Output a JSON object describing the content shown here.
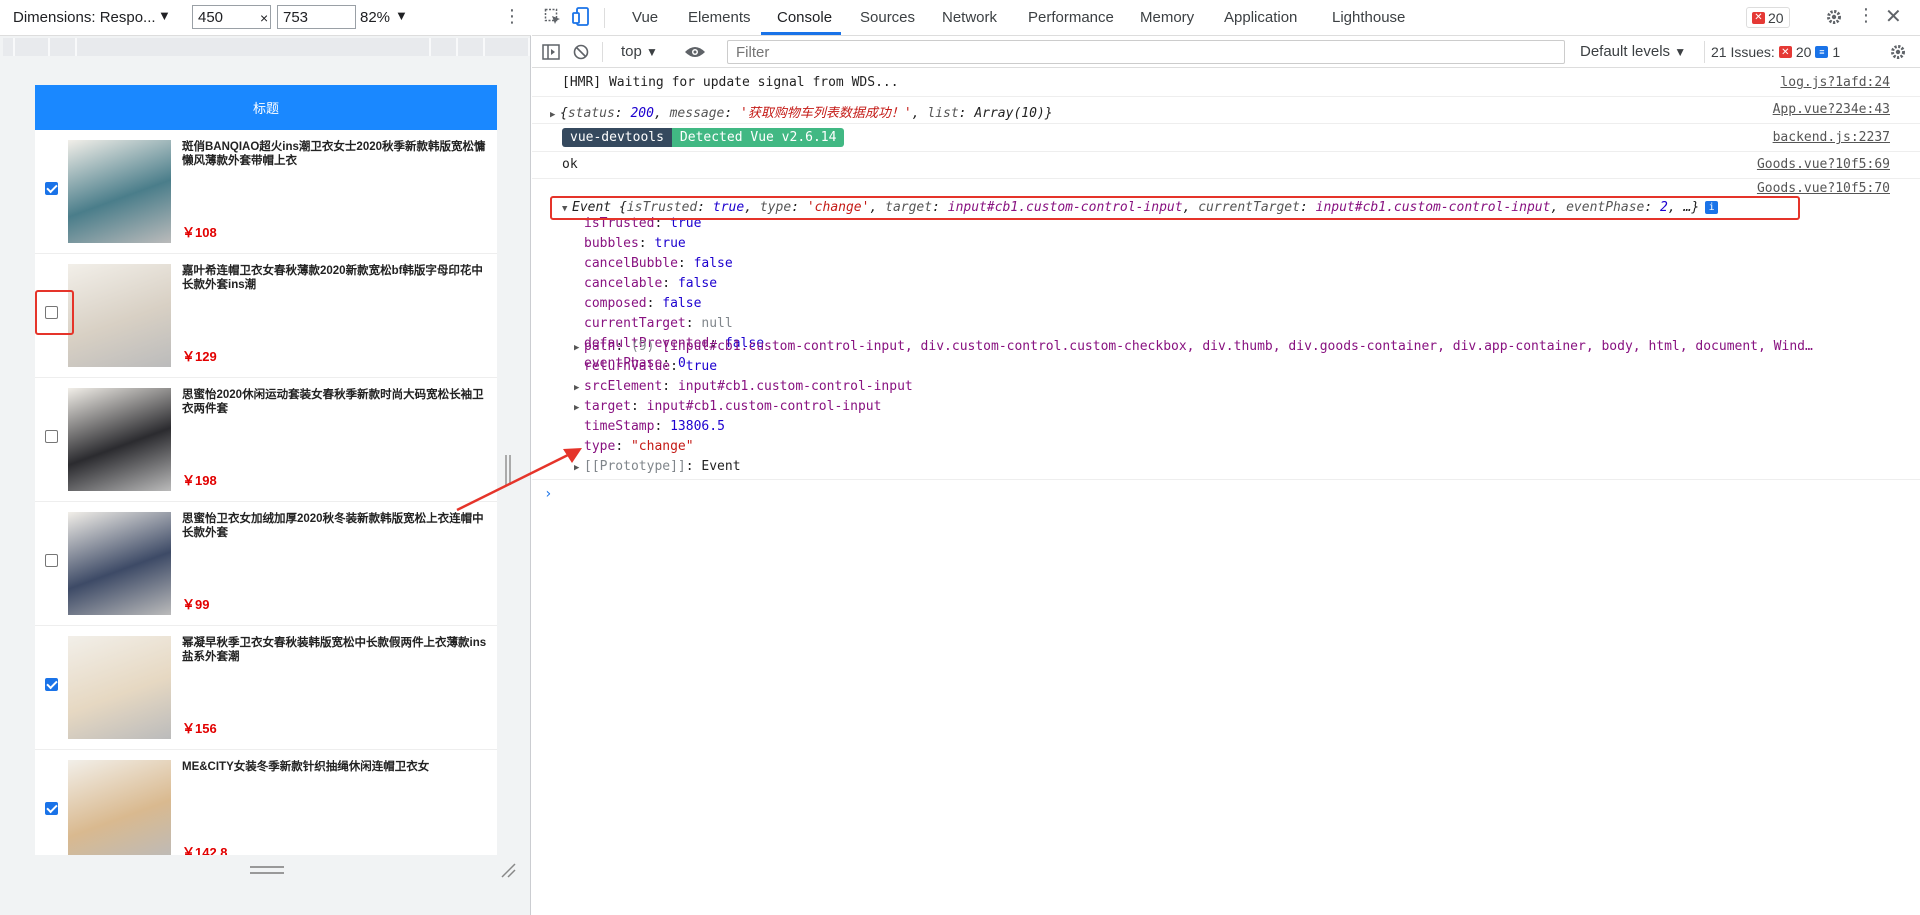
{
  "emulation": {
    "device_label": "Dimensions: Respo...",
    "width": "450",
    "height": "753",
    "times": "×",
    "zoom": "82%",
    "caret": "▼",
    "more": "⋮"
  },
  "app": {
    "header_title": "标题",
    "goods": [
      {
        "title": "斑俏BANQIAO超火ins潮卫衣女士2020秋季新款韩版宽松慵懒风薄款外套带帽上衣",
        "price": "￥108",
        "checked": true,
        "img_color": "#4a7d8a"
      },
      {
        "title": "嘉叶希连帽卫衣女春秋薄款2020新款宽松bf韩版字母印花中长款外套ins潮",
        "price": "￥129",
        "checked": false,
        "img_color": "#d8d0c4"
      },
      {
        "title": "思蜜怡2020休闲运动套装女春秋季新款时尚大码宽松长袖卫衣两件套",
        "price": "￥198",
        "checked": false,
        "img_color": "#2b2b2f"
      },
      {
        "title": "思蜜怡卫衣女加绒加厚2020秋冬装新款韩版宽松上衣连帽中长款外套",
        "price": "￥99",
        "checked": false,
        "img_color": "#3d4a66"
      },
      {
        "title": "幂凝早秋季卫衣女春秋装韩版宽松中长款假两件上衣薄款ins盐系外套潮",
        "price": "￥156",
        "checked": true,
        "img_color": "#e6d8c2"
      },
      {
        "title": "ME&CITY女装冬季新款针织抽绳休闲连帽卫衣女",
        "price": "￥142.8",
        "checked": true,
        "img_color": "#d9b98f"
      }
    ]
  },
  "devtools": {
    "tabs": [
      "Vue",
      "Elements",
      "Console",
      "Sources",
      "Network",
      "Performance",
      "Memory",
      "Application",
      "Lighthouse"
    ],
    "active_tab": "Console",
    "error_count": "20",
    "context": "top",
    "filter_placeholder": "Filter",
    "levels": "Default levels",
    "issues_label": "21 Issues:",
    "issues_errors": "20",
    "issues_info": "1",
    "colors": {
      "accent": "#1a73e8",
      "error": "#e53935",
      "highlight": "#e5342a"
    }
  },
  "console": {
    "line1": {
      "text": "[HMR] Waiting for update signal from WDS...",
      "source": "log.js?1afd:24"
    },
    "line2": {
      "open": "{",
      "status_key": "status",
      "status_val": "200",
      "message_key": "message",
      "message_val": "'获取购物车列表数据成功！'",
      "list_key": "list",
      "list_val": "Array(10)",
      "close": "}",
      "source": "App.vue?234e:43"
    },
    "line3": {
      "badge_a": "vue-devtools",
      "badge_b": "Detected Vue v2.6.14",
      "source": "backend.js:2237"
    },
    "line4": {
      "text": "ok",
      "source": "Goods.vue?10f5:69"
    },
    "line5": {
      "source": "Goods.vue?10f5:70"
    },
    "event_summary": {
      "name": "Event",
      "p1k": "isTrusted",
      "p1v": "true",
      "p2k": "type",
      "p2v": "'change'",
      "p3k": "target",
      "p3v": "input#cb1.custom-control-input",
      "p4k": "currentTarget",
      "p4v": "input#cb1.custom-control-input",
      "p5k": "eventPhase",
      "p5v": "2",
      "ellipsis": "…}"
    },
    "props": [
      {
        "key": "isTrusted",
        "val": "true",
        "kind": "n"
      },
      {
        "key": "bubbles",
        "val": "true",
        "kind": "n"
      },
      {
        "key": "cancelBubble",
        "val": "false",
        "kind": "n"
      },
      {
        "key": "cancelable",
        "val": "false",
        "kind": "n"
      },
      {
        "key": "composed",
        "val": "false",
        "kind": "n"
      },
      {
        "key": "currentTarget",
        "val": "null",
        "kind": "gray"
      },
      {
        "key": "defaultPrevented",
        "val": "false",
        "kind": "n"
      },
      {
        "key": "eventPhase",
        "val": "0",
        "kind": "n"
      }
    ],
    "path_line": {
      "key": "path",
      "count": "(9)",
      "items": "[input#cb1.custom-control-input, div.custom-control.custom-checkbox, div.thumb, div.goods-container, div.app-container, body, html, document, Wind…"
    },
    "returnValue": {
      "key": "returnValue",
      "val": "true"
    },
    "srcElement": {
      "key": "srcElement",
      "val": "input#cb1.custom-control-input"
    },
    "target": {
      "key": "target",
      "val": "input#cb1.custom-control-input"
    },
    "timeStamp": {
      "key": "timeStamp",
      "val": "13806.5"
    },
    "type": {
      "key": "type",
      "val": "\"change\""
    },
    "proto": {
      "key": "[[Prototype]]",
      "val": "Event"
    },
    "prompt": "›"
  }
}
